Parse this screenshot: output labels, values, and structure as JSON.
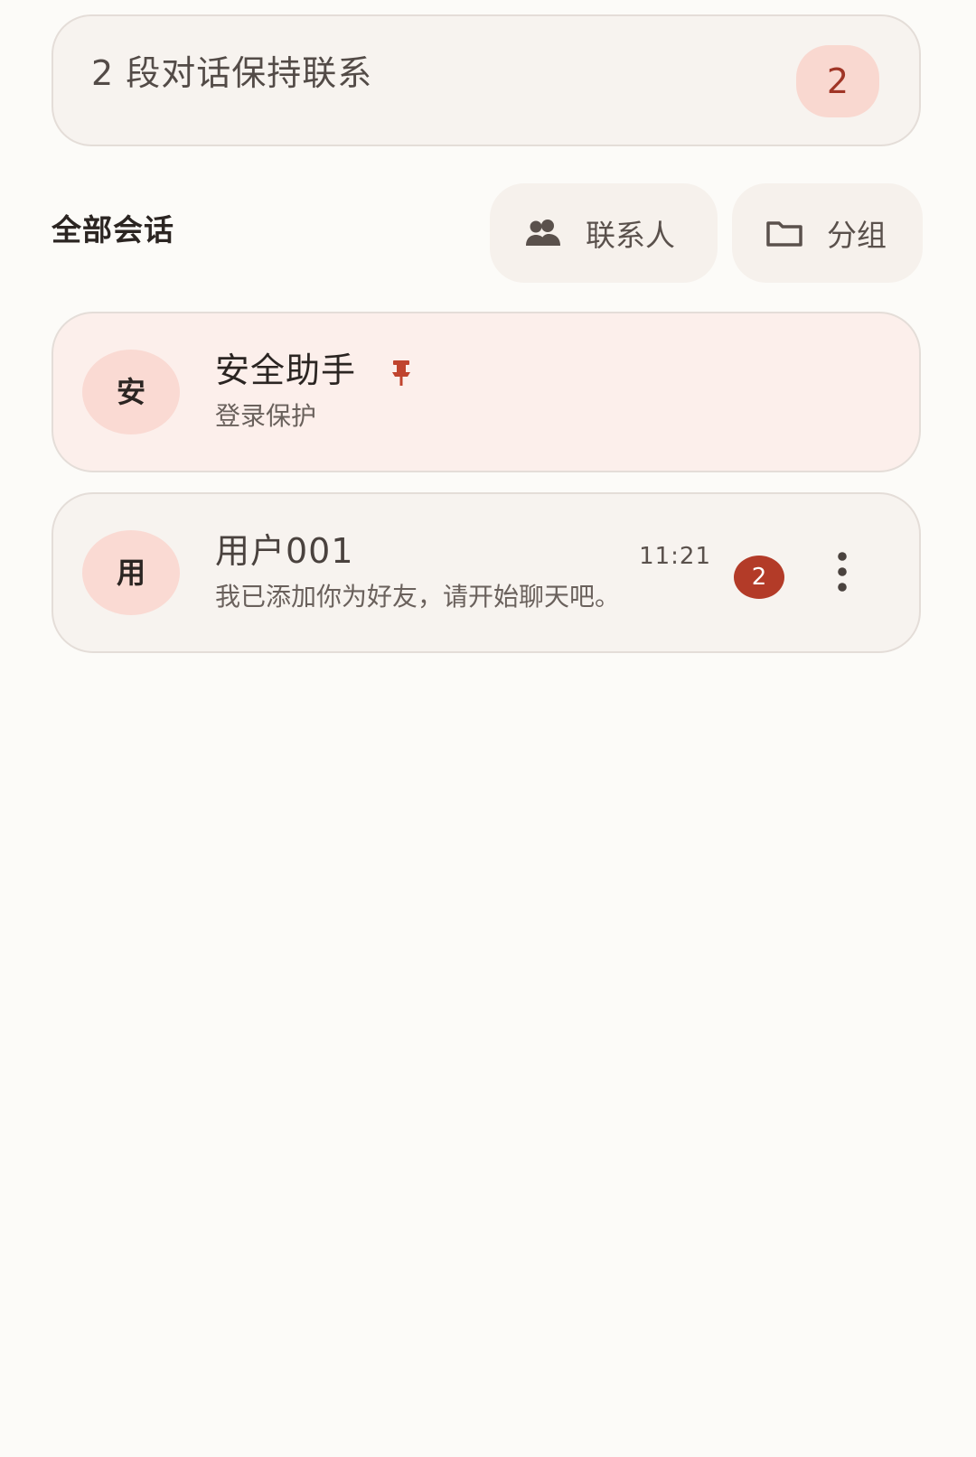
{
  "summary": {
    "text": "2 段对话保持联系",
    "count": "2"
  },
  "header": {
    "title": "全部会话",
    "contacts_label": "联系人",
    "groups_label": "分组"
  },
  "conversations": [
    {
      "avatar": "安",
      "name": "安全助手",
      "subtitle": "登录保护",
      "pinned": true,
      "pin_icon": "pin-icon"
    },
    {
      "avatar": "用",
      "name": "用户001",
      "subtitle": "我已添加你为好友，请开始聊天吧。",
      "time": "11:21",
      "unread": "2",
      "menu_icon": "more-vertical-icon"
    }
  ],
  "colors": {
    "background": "#fcfbf8",
    "accent": "#b33b28",
    "badge_bg": "#f9d8d0",
    "avatar_bg": "#fadad3",
    "pinned_card_bg": "#fcefeb"
  }
}
